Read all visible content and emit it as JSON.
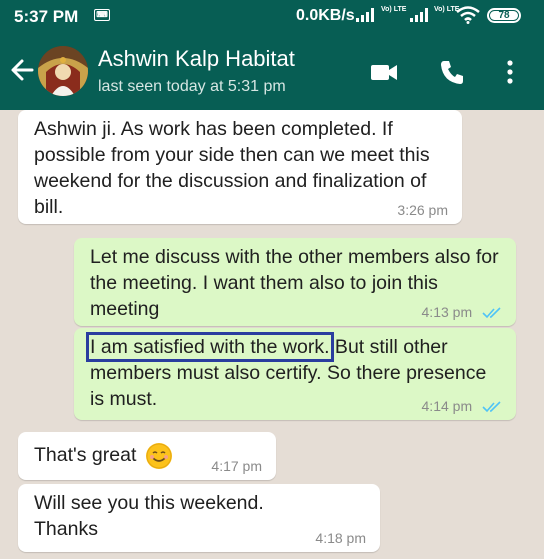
{
  "status_bar": {
    "time": "5:37 PM",
    "network_speed": "0.0KB/s",
    "lte_label": "Vo) LTE",
    "battery": "78"
  },
  "header": {
    "contact_name": "Ashwin Kalp Habitat",
    "last_seen": "last seen today at 5:31 pm"
  },
  "messages": [
    {
      "direction": "in",
      "text": "Ashwin ji. As work has been completed. If possible from your side then can we meet this weekend for the discussion and finalization of bill.",
      "time": "3:26 pm"
    },
    {
      "direction": "out",
      "text": "Let me discuss with the other members also for the meeting. I want them also to join this meeting",
      "time": "4:13 pm",
      "status": "read"
    },
    {
      "direction": "out",
      "highlight_text": "I am satisfied with the work.",
      "text": " But still other members must also certify. So there presence is must.",
      "time": "4:14 pm",
      "status": "read"
    },
    {
      "direction": "in",
      "text": "That's great",
      "emoji": "smiling-face-emoji",
      "time": "4:17 pm"
    },
    {
      "direction": "in",
      "text": "Will see you this weekend. Thanks",
      "time": "4:18 pm"
    }
  ],
  "colors": {
    "header_bg": "#075e54",
    "outgoing_bubble": "#dcf8c6",
    "incoming_bubble": "#ffffff",
    "read_tick": "#4fc3f7",
    "highlight_box": "#2a3d9f"
  },
  "icons": [
    "back-arrow-icon",
    "video-call-icon",
    "phone-icon",
    "more-options-icon",
    "wifi-icon",
    "battery-icon",
    "signal-icon"
  ]
}
